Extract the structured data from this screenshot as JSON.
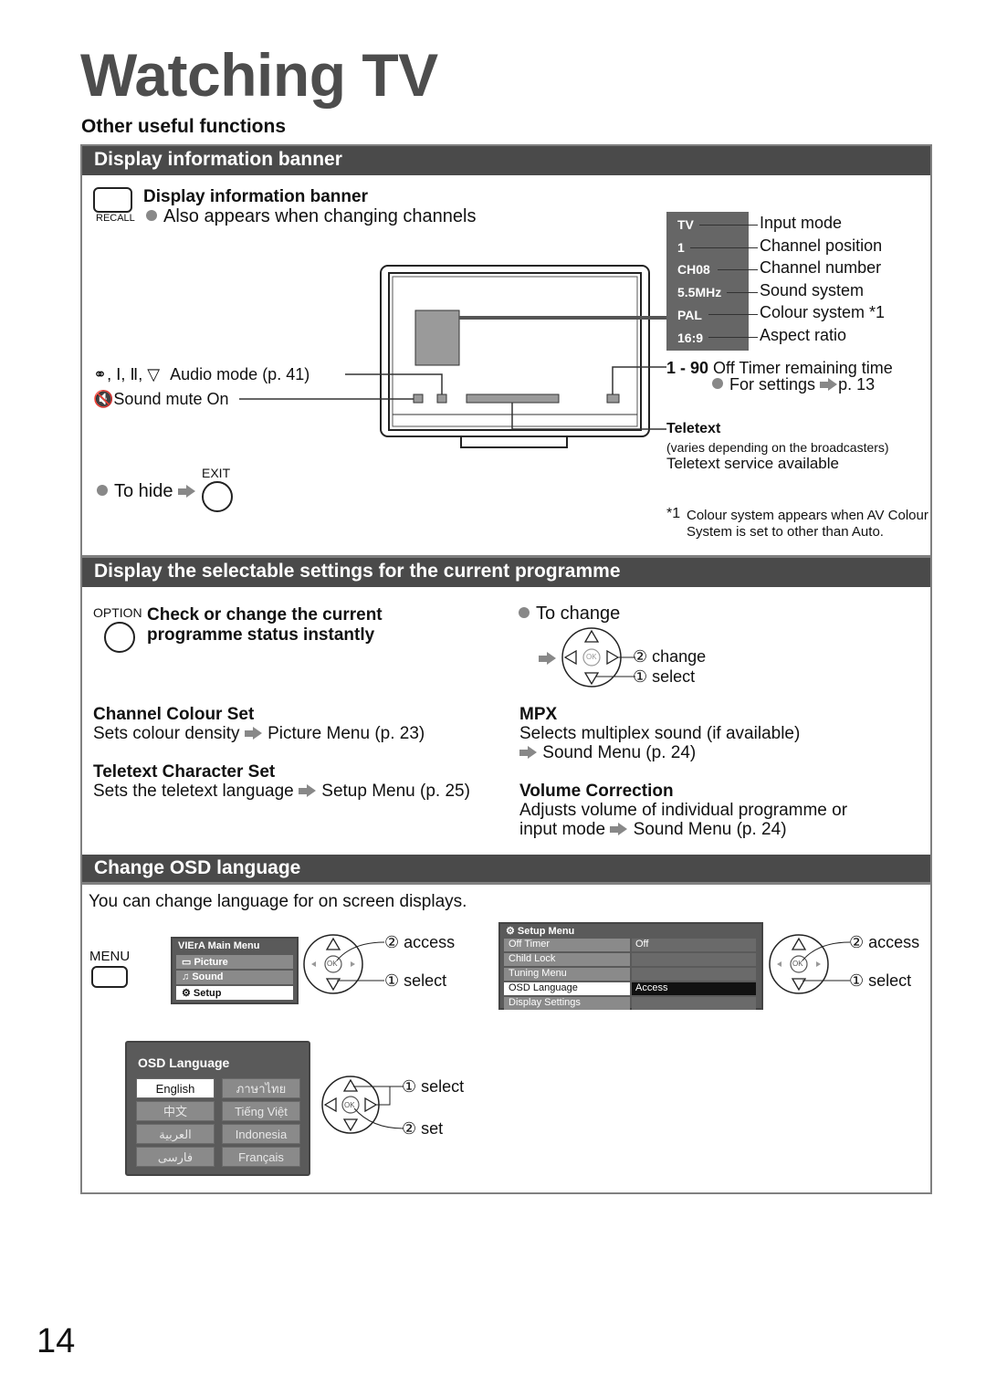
{
  "page": {
    "title": "Watching TV",
    "subtitle": "Other useful functions",
    "page_number": "14"
  },
  "section1": {
    "title": "Display information banner",
    "recall_label": "RECALL",
    "heading": "Display information banner",
    "bullet": "Also appears when changing channels",
    "banner_lines": [
      {
        "value": "TV",
        "label": "Input mode"
      },
      {
        "value": "1",
        "label": "Channel position"
      },
      {
        "value": "CH08",
        "label": "Channel number"
      },
      {
        "value": "5.5MHz",
        "label": "Sound system"
      },
      {
        "value": "PAL",
        "label": "Colour system *1"
      },
      {
        "value": "16:9",
        "label": "Aspect ratio"
      }
    ],
    "audio_mode": "Audio mode (p. 41)",
    "sound_mute": "Sound mute On",
    "off_timer_range": "1 - 90",
    "off_timer_label": "Off Timer remaining time",
    "for_settings": "For settings",
    "for_settings_page": "p. 13",
    "teletext_title": "Teletext",
    "teletext_note": "(varies depending on the broadcasters)",
    "teletext_desc": "Teletext service available",
    "to_hide": "To hide",
    "exit_label": "EXIT",
    "footnote_mark": "*1",
    "footnote_line1": "Colour system appears when AV Colour",
    "footnote_line2": "System is set to other than Auto."
  },
  "section2": {
    "title": "Display the selectable settings for the current programme",
    "option_label": "OPTION",
    "heading_line1": "Check or change the current",
    "heading_line2": "programme status instantly",
    "to_change": "To change",
    "change_label": "② change",
    "select_label": "① select",
    "ok_label": "OK",
    "items_left": [
      {
        "title": "Channel Colour Set",
        "desc": "Sets colour density",
        "target": "Picture Menu (p. 23)"
      },
      {
        "title": "Teletext Character Set",
        "desc": "Sets the teletext language",
        "target": "Setup Menu (p. 25)"
      }
    ],
    "items_right": [
      {
        "title": "MPX",
        "desc": "Selects multiplex sound (if available)",
        "target": "Sound Menu (p. 24)"
      },
      {
        "title": "Volume Correction",
        "desc": "Adjusts volume of individual programme or",
        "desc2": "input mode",
        "target": "Sound Menu (p. 24)"
      }
    ]
  },
  "section3": {
    "title": "Change OSD language",
    "intro": "You can change language for on screen displays.",
    "menu_label": "MENU",
    "main_menu": {
      "title": "VIErA Main Menu",
      "items": [
        "Picture",
        "Sound",
        "Setup"
      ],
      "selected": "Setup"
    },
    "access_label": "② access",
    "select_label": "① select",
    "set_label": "② set",
    "select1_label": "① select",
    "ok_label": "OK",
    "setup_menu": {
      "title": "Setup Menu",
      "rows": [
        {
          "key": "Off Timer",
          "value": "Off"
        },
        {
          "key": "Child Lock",
          "value": ""
        },
        {
          "key": "Tuning Menu",
          "value": ""
        },
        {
          "key": "OSD Language",
          "value": "Access"
        },
        {
          "key": "Display Settings",
          "value": ""
        }
      ],
      "selected": "OSD Language"
    },
    "osd_language": {
      "title": "OSD Language",
      "options": [
        "English",
        "ภาษาไทย",
        "中文",
        "Tiếng Việt",
        "العربية",
        "Indonesia",
        "فارسی",
        "Français"
      ],
      "selected": "English"
    }
  },
  "colors": {
    "section_bar": "#4a4a4a",
    "title_gray": "#4d4d4d",
    "bullet_gray": "#888888",
    "osd_bg": "#5a5a5a"
  }
}
